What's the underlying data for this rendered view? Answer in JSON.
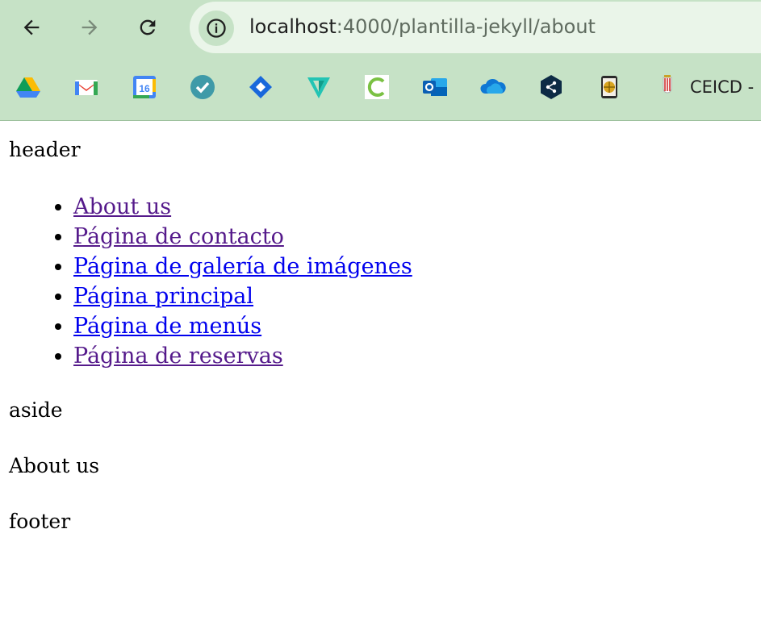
{
  "browser": {
    "url_host": "localhost",
    "url_path": ":4000/plantilla-jekyll/about",
    "bookmarks": [
      {
        "icon": "google-drive-icon"
      },
      {
        "icon": "gmail-icon"
      },
      {
        "icon": "google-calendar-icon",
        "text": "16"
      },
      {
        "icon": "checkmark-app-icon"
      },
      {
        "icon": "jira-icon"
      },
      {
        "icon": "v-app-icon"
      },
      {
        "icon": "c-app-icon"
      },
      {
        "icon": "outlook-icon"
      },
      {
        "icon": "onedrive-icon"
      },
      {
        "icon": "share-hexagon-icon"
      },
      {
        "icon": "globe-tablet-icon"
      },
      {
        "icon": "crest-icon"
      }
    ],
    "bookmark_label": "CEICD -"
  },
  "page": {
    "header": "header",
    "nav": [
      {
        "label": "About us",
        "visited": true
      },
      {
        "label": "Página de contacto",
        "visited": true
      },
      {
        "label": "Página de galería de imágenes",
        "visited": false
      },
      {
        "label": "Página principal",
        "visited": false
      },
      {
        "label": "Página de menús",
        "visited": false
      },
      {
        "label": "Página de reservas",
        "visited": true
      }
    ],
    "aside": "aside",
    "content": "About us",
    "footer": "footer"
  }
}
